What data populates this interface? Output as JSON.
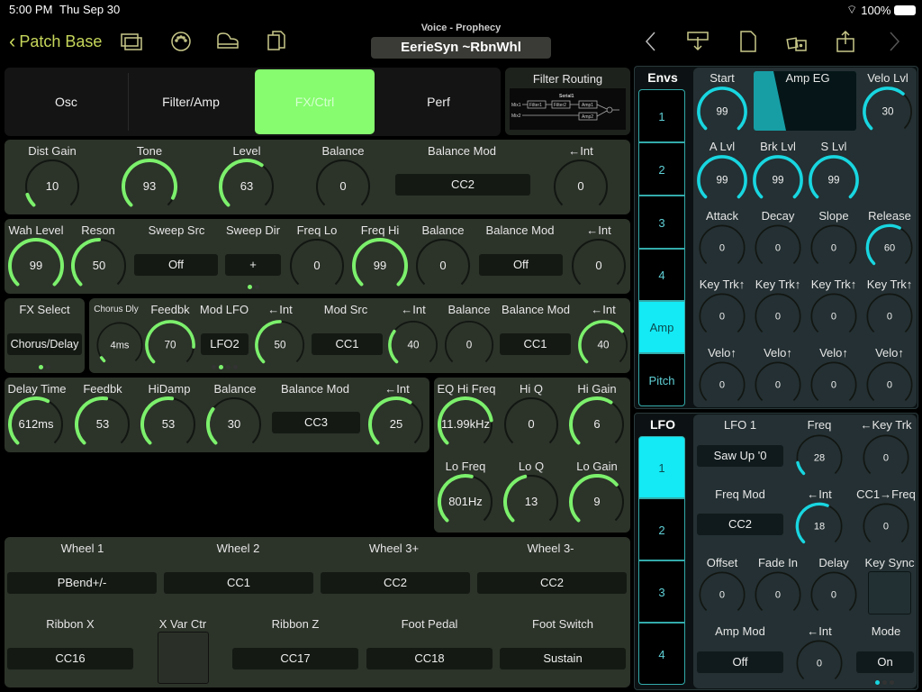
{
  "status": {
    "time": "5:00 PM",
    "date": "Thu Sep 30",
    "battery": "100%"
  },
  "nav": {
    "back_label": "Patch Base",
    "voice_label": "Voice - Prophecy",
    "patch_name": "EerieSyn ~RbnWhl",
    "icons": [
      "windows-icon",
      "midi-icon",
      "piano-icon",
      "copy-icon",
      "prev-icon",
      "download-icon",
      "new-file-icon",
      "random-dice-icon",
      "share-icon",
      "next-icon"
    ]
  },
  "tabs": [
    {
      "label": "Osc"
    },
    {
      "label": "Filter/Amp"
    },
    {
      "label": "FX/Ctrl",
      "active": true
    },
    {
      "label": "Perf"
    }
  ],
  "filter_routing": {
    "title": "Filter Routing",
    "mode": "Serial1",
    "nodes": [
      "Mix1",
      "Mix2",
      "Filter1",
      "Filter2",
      "Amp1",
      "Amp2"
    ]
  },
  "dist": {
    "knobs": [
      {
        "label": "Dist Gain",
        "value": "10",
        "pct": 0.1
      },
      {
        "label": "Tone",
        "value": "93",
        "pct": 0.93
      },
      {
        "label": "Level",
        "value": "63",
        "pct": 0.63
      },
      {
        "label": "Balance",
        "value": "0",
        "pct": 0
      },
      {
        "label": "←Int",
        "value": "0",
        "pct": 0
      }
    ],
    "balance_mod": {
      "label": "Balance Mod",
      "value": "CC2"
    }
  },
  "wah": {
    "knobs": [
      {
        "label": "Wah Level",
        "value": "99",
        "pct": 1
      },
      {
        "label": "Reson",
        "value": "50",
        "pct": 0.5
      },
      {
        "label": "Freq Lo",
        "value": "0",
        "pct": 0
      },
      {
        "label": "Freq Hi",
        "value": "99",
        "pct": 1
      },
      {
        "label": "Balance",
        "value": "0",
        "pct": 0
      },
      {
        "label": "←Int",
        "value": "0",
        "pct": 0
      }
    ],
    "sweep_src": {
      "label": "Sweep Src",
      "value": "Off"
    },
    "sweep_dir": {
      "label": "Sweep Dir",
      "value": "+"
    },
    "balance_mod": {
      "label": "Balance Mod",
      "value": "Off"
    }
  },
  "fx_select": {
    "label": "FX Select",
    "value": "Chorus/Delay"
  },
  "chorus": {
    "knobs": [
      {
        "label": "Chorus Dly",
        "value": "4ms",
        "pct": 0.04
      },
      {
        "label": "Feedbk",
        "value": "70",
        "pct": 0.85
      },
      {
        "label": "←Int",
        "value": "50",
        "pct": 0.5
      },
      {
        "label": "←Int",
        "value": "40",
        "pct": 0.3
      },
      {
        "label": "Balance",
        "value": "0",
        "pct": 0
      },
      {
        "label": "←Int",
        "value": "40",
        "pct": 0.7
      }
    ],
    "mod_lfo": {
      "label": "Mod LFO",
      "value": "LFO2"
    },
    "mod_src": {
      "label": "Mod Src",
      "value": "CC1"
    },
    "balance_mod": {
      "label": "Balance Mod",
      "value": "CC1"
    }
  },
  "delay": {
    "knobs": [
      {
        "label": "Delay Time",
        "value": "612ms",
        "pct": 0.6
      },
      {
        "label": "Feedbk",
        "value": "53",
        "pct": 0.53
      },
      {
        "label": "HiDamp",
        "value": "53",
        "pct": 0.53
      },
      {
        "label": "Balance",
        "value": "30",
        "pct": 0.3
      },
      {
        "label": "←Int",
        "value": "25",
        "pct": 0.62
      }
    ],
    "balance_mod": {
      "label": "Balance Mod",
      "value": "CC3"
    }
  },
  "eq": {
    "knobs": [
      {
        "label": "EQ Hi Freq",
        "value": "11.99kHz",
        "pct": 0.8
      },
      {
        "label": "Hi Q",
        "value": "0",
        "pct": 0
      },
      {
        "label": "Hi Gain",
        "value": "6",
        "pct": 0.62
      },
      {
        "label": "Lo Freq",
        "value": "801Hz",
        "pct": 0.55
      },
      {
        "label": "Lo Q",
        "value": "13",
        "pct": 0.45
      },
      {
        "label": "Lo Gain",
        "value": "9",
        "pct": 0.68
      }
    ]
  },
  "perf": {
    "wheels": [
      {
        "label": "Wheel 1",
        "value": "PBend+/-"
      },
      {
        "label": "Wheel 2",
        "value": "CC1"
      },
      {
        "label": "Wheel 3+",
        "value": "CC2"
      },
      {
        "label": "Wheel 3-",
        "value": "CC2"
      }
    ],
    "ribbon_x": {
      "label": "Ribbon X",
      "value": "CC16"
    },
    "x_var_ctr": {
      "label": "X Var Ctr"
    },
    "ribbon_z": {
      "label": "Ribbon Z",
      "value": "CC17"
    },
    "foot_pedal": {
      "label": "Foot Pedal",
      "value": "CC18"
    },
    "foot_switch": {
      "label": "Foot Switch",
      "value": "Sustain"
    }
  },
  "envs": {
    "title": "Envs",
    "tabs": [
      "1",
      "2",
      "3",
      "4",
      "Amp",
      "Pitch"
    ],
    "active": "Amp",
    "eg_label": "Amp EG",
    "knobs": [
      {
        "label": "Start",
        "value": "99",
        "pct": 1
      },
      {
        "label": "Velo Lvl",
        "value": "30",
        "pct": 0.65
      },
      {
        "label": "A Lvl",
        "value": "99",
        "pct": 1
      },
      {
        "label": "Brk Lvl",
        "value": "99",
        "pct": 1
      },
      {
        "label": "S Lvl",
        "value": "99",
        "pct": 1
      },
      {
        "label": "Attack",
        "value": "0",
        "pct": 0
      },
      {
        "label": "Decay",
        "value": "0",
        "pct": 0
      },
      {
        "label": "Slope",
        "value": "0",
        "pct": 0
      },
      {
        "label": "Release",
        "value": "60",
        "pct": 0.6
      },
      {
        "label": "Key Trk↑",
        "value": "0",
        "pct": 0
      },
      {
        "label": "Key Trk↑",
        "value": "0",
        "pct": 0
      },
      {
        "label": "Key Trk↑",
        "value": "0",
        "pct": 0
      },
      {
        "label": "Key Trk↑",
        "value": "0",
        "pct": 0
      },
      {
        "label": "Velo↑",
        "value": "0",
        "pct": 0
      },
      {
        "label": "Velo↑",
        "value": "0",
        "pct": 0
      },
      {
        "label": "Velo↑",
        "value": "0",
        "pct": 0
      },
      {
        "label": "Velo↑",
        "value": "0",
        "pct": 0
      }
    ]
  },
  "lfo": {
    "title": "LFO",
    "tabs": [
      "1",
      "2",
      "3",
      "4"
    ],
    "active": "1",
    "name_label": "LFO 1",
    "wave": "Saw Up '0",
    "freq_mod": {
      "label": "Freq Mod",
      "value": "CC2"
    },
    "amp_mod": {
      "label": "Amp Mod",
      "value": "Off"
    },
    "key_sync": {
      "label": "Key Sync"
    },
    "mode": {
      "label": "Mode",
      "value": "On"
    },
    "knobs": [
      {
        "label": "Freq",
        "value": "28",
        "pct": 0.12
      },
      {
        "label": "←Key Trk",
        "value": "0",
        "pct": 0
      },
      {
        "label": "←Int",
        "value": "18",
        "pct": 0.58
      },
      {
        "label": "CC1→Freq",
        "value": "0",
        "pct": 0
      },
      {
        "label": "Offset",
        "value": "0",
        "pct": 0
      },
      {
        "label": "Fade In",
        "value": "0",
        "pct": 0
      },
      {
        "label": "Delay",
        "value": "0",
        "pct": 0
      },
      {
        "label": "←Int",
        "value": "0",
        "pct": 0
      }
    ]
  },
  "colors": {
    "green": "#7cf06c",
    "cyan": "#18d6e0",
    "tab_active": "#86fc6e"
  }
}
